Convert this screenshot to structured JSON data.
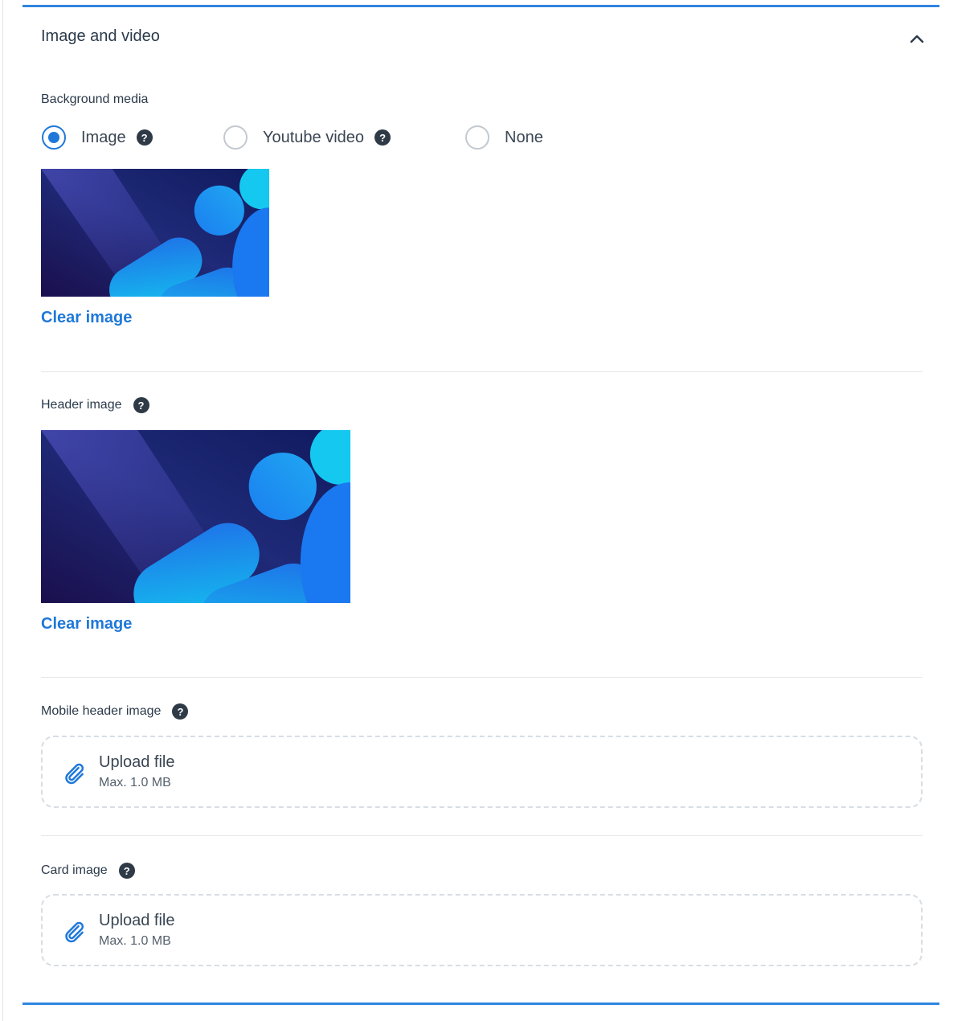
{
  "section": {
    "title": "Image and video"
  },
  "background_media": {
    "label": "Background media",
    "options": [
      {
        "label": "Image",
        "checked": true,
        "has_help": true
      },
      {
        "label": "Youtube video",
        "checked": false,
        "has_help": true
      },
      {
        "label": "None",
        "checked": false,
        "has_help": false
      }
    ],
    "clear_label": "Clear image"
  },
  "header_image": {
    "label": "Header image",
    "clear_label": "Clear image"
  },
  "mobile_header_image": {
    "label": "Mobile header image",
    "upload_title": "Upload file",
    "upload_limit": "Max. 1.0 MB"
  },
  "card_image": {
    "label": "Card image",
    "upload_title": "Upload file",
    "upload_limit": "Max. 1.0 MB"
  },
  "icons": {
    "help": "question-mark-circle-icon",
    "collapse": "chevron-up-icon",
    "attach": "paperclip-icon"
  },
  "colors": {
    "accent": "#1f78d9",
    "rule": "#2f86e0",
    "help_icon_bg": "#2e3a46"
  }
}
